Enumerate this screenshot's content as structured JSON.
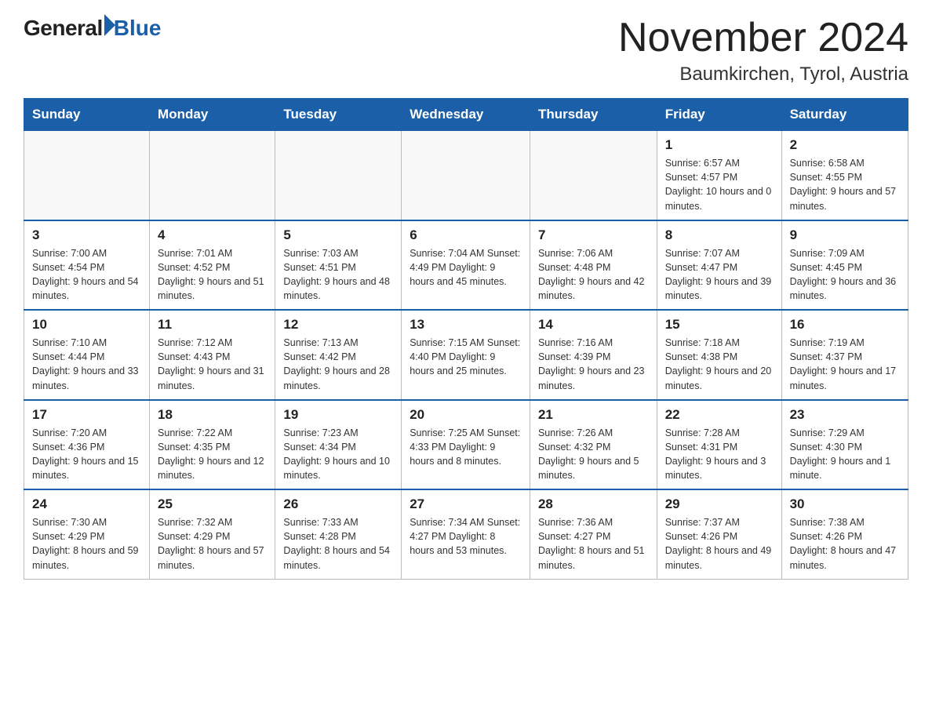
{
  "logo": {
    "text_general": "General",
    "text_blue": "Blue"
  },
  "header": {
    "title": "November 2024",
    "subtitle": "Baumkirchen, Tyrol, Austria"
  },
  "weekdays": [
    "Sunday",
    "Monday",
    "Tuesday",
    "Wednesday",
    "Thursday",
    "Friday",
    "Saturday"
  ],
  "weeks": [
    [
      {
        "day": "",
        "info": ""
      },
      {
        "day": "",
        "info": ""
      },
      {
        "day": "",
        "info": ""
      },
      {
        "day": "",
        "info": ""
      },
      {
        "day": "",
        "info": ""
      },
      {
        "day": "1",
        "info": "Sunrise: 6:57 AM\nSunset: 4:57 PM\nDaylight: 10 hours\nand 0 minutes."
      },
      {
        "day": "2",
        "info": "Sunrise: 6:58 AM\nSunset: 4:55 PM\nDaylight: 9 hours\nand 57 minutes."
      }
    ],
    [
      {
        "day": "3",
        "info": "Sunrise: 7:00 AM\nSunset: 4:54 PM\nDaylight: 9 hours\nand 54 minutes."
      },
      {
        "day": "4",
        "info": "Sunrise: 7:01 AM\nSunset: 4:52 PM\nDaylight: 9 hours\nand 51 minutes."
      },
      {
        "day": "5",
        "info": "Sunrise: 7:03 AM\nSunset: 4:51 PM\nDaylight: 9 hours\nand 48 minutes."
      },
      {
        "day": "6",
        "info": "Sunrise: 7:04 AM\nSunset: 4:49 PM\nDaylight: 9 hours\nand 45 minutes."
      },
      {
        "day": "7",
        "info": "Sunrise: 7:06 AM\nSunset: 4:48 PM\nDaylight: 9 hours\nand 42 minutes."
      },
      {
        "day": "8",
        "info": "Sunrise: 7:07 AM\nSunset: 4:47 PM\nDaylight: 9 hours\nand 39 minutes."
      },
      {
        "day": "9",
        "info": "Sunrise: 7:09 AM\nSunset: 4:45 PM\nDaylight: 9 hours\nand 36 minutes."
      }
    ],
    [
      {
        "day": "10",
        "info": "Sunrise: 7:10 AM\nSunset: 4:44 PM\nDaylight: 9 hours\nand 33 minutes."
      },
      {
        "day": "11",
        "info": "Sunrise: 7:12 AM\nSunset: 4:43 PM\nDaylight: 9 hours\nand 31 minutes."
      },
      {
        "day": "12",
        "info": "Sunrise: 7:13 AM\nSunset: 4:42 PM\nDaylight: 9 hours\nand 28 minutes."
      },
      {
        "day": "13",
        "info": "Sunrise: 7:15 AM\nSunset: 4:40 PM\nDaylight: 9 hours\nand 25 minutes."
      },
      {
        "day": "14",
        "info": "Sunrise: 7:16 AM\nSunset: 4:39 PM\nDaylight: 9 hours\nand 23 minutes."
      },
      {
        "day": "15",
        "info": "Sunrise: 7:18 AM\nSunset: 4:38 PM\nDaylight: 9 hours\nand 20 minutes."
      },
      {
        "day": "16",
        "info": "Sunrise: 7:19 AM\nSunset: 4:37 PM\nDaylight: 9 hours\nand 17 minutes."
      }
    ],
    [
      {
        "day": "17",
        "info": "Sunrise: 7:20 AM\nSunset: 4:36 PM\nDaylight: 9 hours\nand 15 minutes."
      },
      {
        "day": "18",
        "info": "Sunrise: 7:22 AM\nSunset: 4:35 PM\nDaylight: 9 hours\nand 12 minutes."
      },
      {
        "day": "19",
        "info": "Sunrise: 7:23 AM\nSunset: 4:34 PM\nDaylight: 9 hours\nand 10 minutes."
      },
      {
        "day": "20",
        "info": "Sunrise: 7:25 AM\nSunset: 4:33 PM\nDaylight: 9 hours\nand 8 minutes."
      },
      {
        "day": "21",
        "info": "Sunrise: 7:26 AM\nSunset: 4:32 PM\nDaylight: 9 hours\nand 5 minutes."
      },
      {
        "day": "22",
        "info": "Sunrise: 7:28 AM\nSunset: 4:31 PM\nDaylight: 9 hours\nand 3 minutes."
      },
      {
        "day": "23",
        "info": "Sunrise: 7:29 AM\nSunset: 4:30 PM\nDaylight: 9 hours\nand 1 minute."
      }
    ],
    [
      {
        "day": "24",
        "info": "Sunrise: 7:30 AM\nSunset: 4:29 PM\nDaylight: 8 hours\nand 59 minutes."
      },
      {
        "day": "25",
        "info": "Sunrise: 7:32 AM\nSunset: 4:29 PM\nDaylight: 8 hours\nand 57 minutes."
      },
      {
        "day": "26",
        "info": "Sunrise: 7:33 AM\nSunset: 4:28 PM\nDaylight: 8 hours\nand 54 minutes."
      },
      {
        "day": "27",
        "info": "Sunrise: 7:34 AM\nSunset: 4:27 PM\nDaylight: 8 hours\nand 53 minutes."
      },
      {
        "day": "28",
        "info": "Sunrise: 7:36 AM\nSunset: 4:27 PM\nDaylight: 8 hours\nand 51 minutes."
      },
      {
        "day": "29",
        "info": "Sunrise: 7:37 AM\nSunset: 4:26 PM\nDaylight: 8 hours\nand 49 minutes."
      },
      {
        "day": "30",
        "info": "Sunrise: 7:38 AM\nSunset: 4:26 PM\nDaylight: 8 hours\nand 47 minutes."
      }
    ]
  ]
}
